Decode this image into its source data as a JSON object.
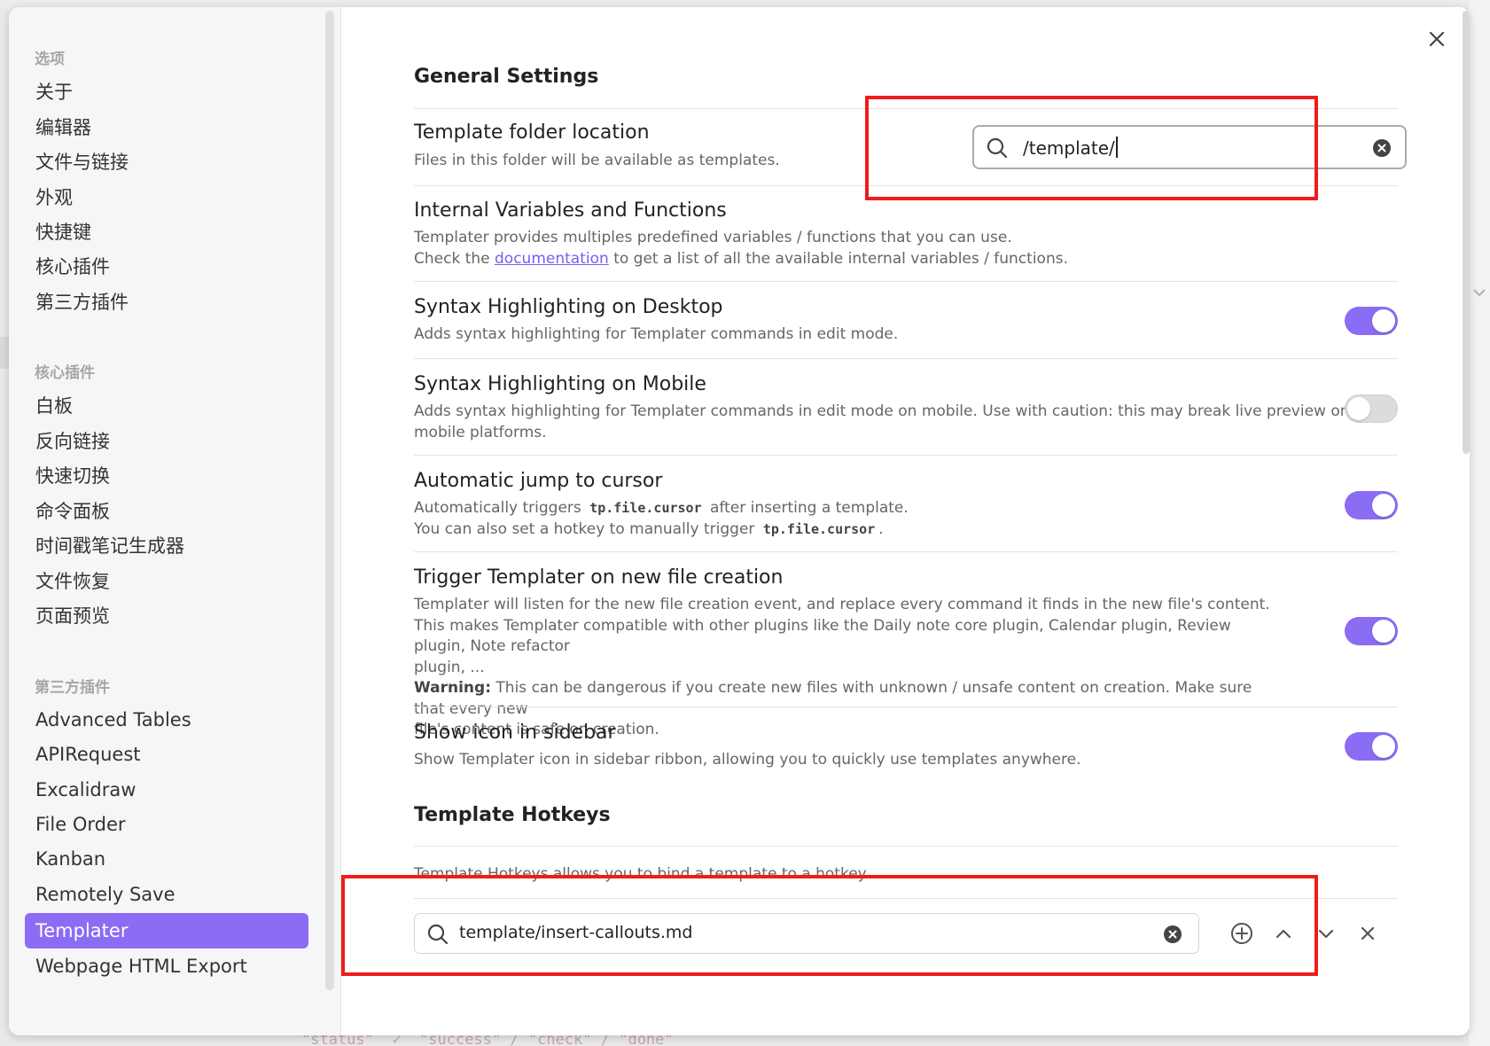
{
  "sidebar": {
    "headings": {
      "options": "选项",
      "core_plugins": "核心插件",
      "community_plugins": "第三方插件"
    },
    "options_items": [
      "关于",
      "编辑器",
      "文件与链接",
      "外观",
      "快捷键",
      "核心插件",
      "第三方插件"
    ],
    "core_items": [
      "白板",
      "反向链接",
      "快速切换",
      "命令面板",
      "时间戳笔记生成器",
      "文件恢复",
      "页面预览"
    ],
    "community_items": [
      "Advanced Tables",
      "APIRequest",
      "Excalidraw",
      "File Order",
      "Kanban",
      "Remotely Save",
      "Templater",
      "Webpage HTML Export"
    ],
    "active_item": "Templater"
  },
  "content": {
    "general_title": "General Settings",
    "template_folder": {
      "name": "Template folder location",
      "desc": "Files in this folder will be available as templates.",
      "value": "/template/"
    },
    "internal_vars": {
      "name": "Internal Variables and Functions",
      "desc_line1": "Templater provides multiples predefined variables / functions that you can use.",
      "desc_pre": "Check the",
      "desc_link": "documentation",
      "desc_post": "to get a list of all the available internal variables / functions."
    },
    "syntax_desktop": {
      "name": "Syntax Highlighting on Desktop",
      "desc": "Adds syntax highlighting for Templater commands in edit mode.",
      "enabled": true
    },
    "syntax_mobile": {
      "name": "Syntax Highlighting on Mobile",
      "desc_line1": "Adds syntax highlighting for Templater commands in edit mode on mobile. Use with caution: this may break live preview on",
      "desc_line2": "mobile platforms.",
      "enabled": false
    },
    "auto_jump": {
      "name": "Automatic jump to cursor",
      "desc1_pre": "Automatically triggers",
      "desc1_code": "tp.file.cursor",
      "desc1_post": "after inserting a template.",
      "desc2_pre": "You can also set a hotkey to manually trigger",
      "desc2_code": "tp.file.cursor",
      "desc2_post": ".",
      "enabled": true
    },
    "trigger_new_file": {
      "name": "Trigger Templater on new file creation",
      "desc_line1": "Templater will listen for the new file creation event, and replace every command it finds in the new file's content.",
      "desc_line2": "This makes Templater compatible with other plugins like the Daily note core plugin, Calendar plugin, Review plugin, Note refactor",
      "desc_line3": "plugin, ...",
      "warning_label": "Warning:",
      "warning_text": "This can be dangerous if you create new files with unknown / unsafe content on creation. Make sure that every new",
      "warning_line2": "file's content is safe on creation.",
      "enabled": true
    },
    "show_icon": {
      "name": "Show icon in sidebar",
      "desc": "Show Templater icon in sidebar ribbon, allowing you to quickly use templates anywhere.",
      "enabled": true
    },
    "hotkeys_title": "Template Hotkeys",
    "hotkeys_desc": "Template Hotkeys allows you to bind a template to a hotkey.",
    "hotkey_value": "template/insert-callouts.md"
  },
  "background": {
    "bottom_code": "\"status\"  ✓  \"success\" / \"check\" / \"done\""
  },
  "colors": {
    "accent": "#8b6cf4",
    "highlight_box": "#ee1c1c",
    "link": "#7c5cf0"
  },
  "icons": [
    "search-icon",
    "clear-icon",
    "close-icon",
    "add-icon",
    "chevron-up-icon",
    "chevron-down-icon",
    "remove-icon"
  ]
}
